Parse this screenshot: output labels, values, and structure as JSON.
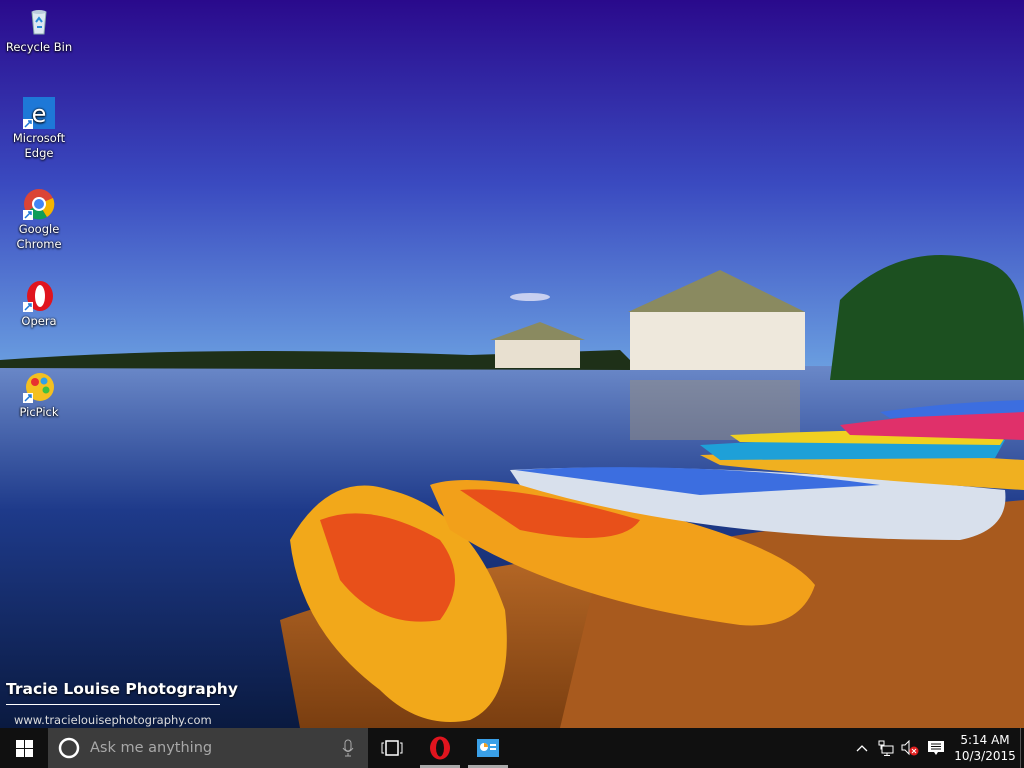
{
  "desktop": {
    "icons": [
      {
        "label": "Recycle Bin",
        "icon": "recycle-bin-icon"
      },
      {
        "label": "Microsoft Edge",
        "icon": "edge-icon"
      },
      {
        "label": "Google Chrome",
        "icon": "chrome-icon"
      },
      {
        "label": "Opera",
        "icon": "opera-icon"
      },
      {
        "label": "PicPick",
        "icon": "picpick-icon"
      }
    ],
    "wallpaper_watermark": {
      "title": "Tracie Louise Photography",
      "url": "www.tracielouisephotography.com"
    }
  },
  "taskbar": {
    "search_placeholder": "Ask me anything",
    "pinned": [
      "task-view-icon",
      "opera-icon",
      "picpick-icon"
    ],
    "tray": {
      "time": "5:14 AM",
      "date": "10/3/2015",
      "icons": [
        "chevron-up-icon",
        "network-icon",
        "volume-muted-icon",
        "action-center-icon"
      ]
    },
    "colors": {
      "taskbar": "#101010",
      "search": "#3c3c3c"
    }
  }
}
